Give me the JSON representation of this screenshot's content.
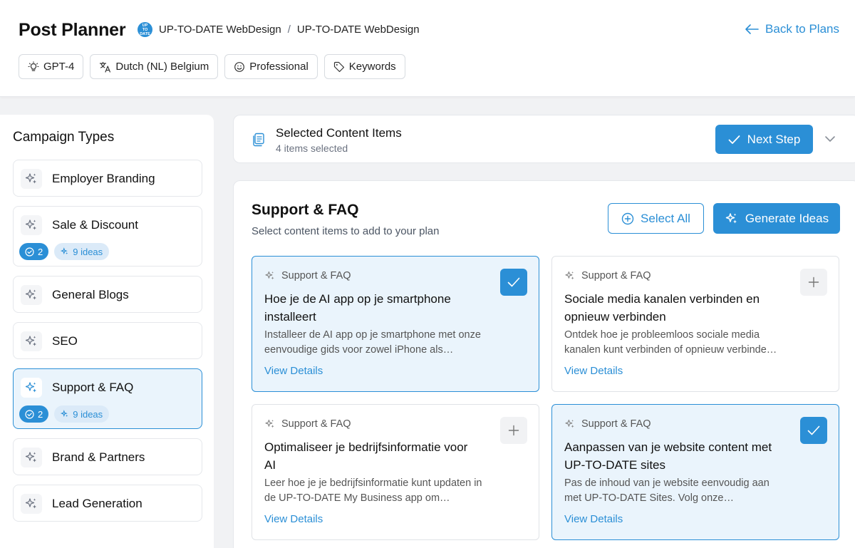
{
  "header": {
    "title": "Post Planner",
    "breadcrumb": {
      "logo_text": "UP TO DATE",
      "org": "UP-TO-DATE WebDesign",
      "sub": "UP-TO-DATE WebDesign"
    },
    "back_label": "Back to Plans",
    "chips": [
      {
        "icon": "lightbulb-icon",
        "label": "GPT-4"
      },
      {
        "icon": "translate-icon",
        "label": "Dutch (NL) Belgium"
      },
      {
        "icon": "smiley-icon",
        "label": "Professional"
      },
      {
        "icon": "tag-icon",
        "label": "Keywords"
      }
    ]
  },
  "sidebar": {
    "title": "Campaign Types",
    "items": [
      {
        "label": "Employer Branding"
      },
      {
        "label": "Sale & Discount",
        "count": "2",
        "ideas": "9 ideas"
      },
      {
        "label": "General Blogs"
      },
      {
        "label": "SEO"
      },
      {
        "label": "Support & FAQ",
        "count": "2",
        "ideas": "9 ideas",
        "active": true
      },
      {
        "label": "Brand & Partners"
      },
      {
        "label": "Lead Generation"
      }
    ]
  },
  "selected_bar": {
    "title": "Selected Content Items",
    "subtitle": "4 items selected",
    "next_label": "Next Step"
  },
  "panel": {
    "title": "Support & FAQ",
    "subtitle": "Select content items to add to your plan",
    "select_all_label": "Select All",
    "generate_label": "Generate Ideas",
    "cards": [
      {
        "category": "Support & FAQ",
        "title": "Hoe je de AI app op je smartphone installeert",
        "desc": "Installeer de AI app op je smartphone met onze eenvoudige gids voor zowel iPhone als…",
        "link": "View Details",
        "selected": true
      },
      {
        "category": "Support & FAQ",
        "title": "Sociale media kanalen verbinden en opnieuw verbinden",
        "desc": "Ontdek hoe je probleemloos sociale media kanalen kunt verbinden of opnieuw verbinde…",
        "link": "View Details",
        "selected": false
      },
      {
        "category": "Support & FAQ",
        "title": "Optimaliseer je bedrijfsinformatie voor AI",
        "desc": "Leer hoe je je bedrijfsinformatie kunt updaten in de UP-TO-DATE My Business app om…",
        "link": "View Details",
        "selected": false
      },
      {
        "category": "Support & FAQ",
        "title": "Aanpassen van je website content met UP-TO-DATE sites",
        "desc": "Pas de inhoud van je website eenvoudig aan met UP-TO-DATE Sites. Volg onze…",
        "link": "View Details",
        "selected": true
      }
    ]
  },
  "colors": {
    "accent": "#2b8fd6",
    "accent_light": "#eaf4fc",
    "background": "#f1f2f4"
  }
}
